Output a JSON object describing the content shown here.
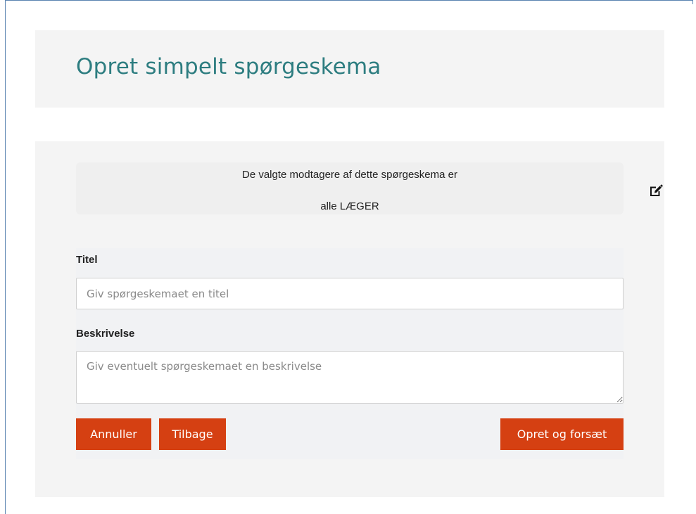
{
  "page": {
    "title": "Opret simpelt spørgeskema"
  },
  "recipients": {
    "intro": "De valgte modtagere af dette spørgeskema er",
    "value": "alle LÆGER",
    "edit_icon": "edit-pencil-square-icon"
  },
  "form": {
    "title_label": "Titel",
    "title_placeholder": "Giv spørgeskemaet en titel",
    "title_value": "",
    "description_label": "Beskrivelse",
    "description_placeholder": "Giv eventuelt spørgeskemaet en beskrivelse",
    "description_value": ""
  },
  "buttons": {
    "cancel": "Annuller",
    "back": "Tilbage",
    "create": "Opret og forsæt"
  },
  "colors": {
    "title": "#2d7d80",
    "button": "#d54012",
    "panel": "#f4f4f4"
  }
}
